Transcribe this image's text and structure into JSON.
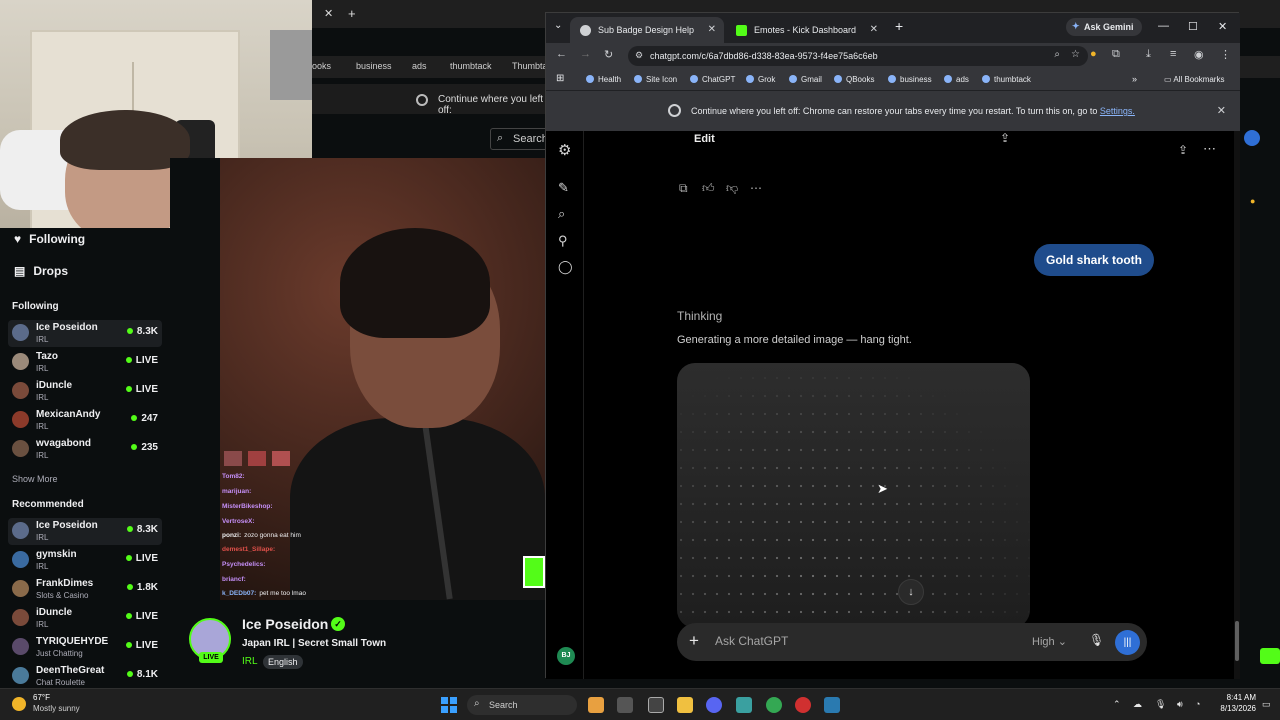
{
  "background_browser": {
    "bookmarks": [
      "ooks",
      "business",
      "ads",
      "thumbtack",
      "Thumbta"
    ],
    "restore_text": "Continue where you left off:",
    "search_label": "Search",
    "gemini_label": "Ask Gemini",
    "bookmarks_right": "ookmarks"
  },
  "kick": {
    "nav": {
      "following": "Following",
      "drops": "Drops"
    },
    "following_heading": "Following",
    "following": [
      {
        "name": "Ice Poseidon",
        "category": "IRL",
        "stat": "8.3K"
      },
      {
        "name": "Tazo",
        "category": "IRL",
        "stat": "LIVE"
      },
      {
        "name": "iDuncle",
        "category": "IRL",
        "stat": "LIVE"
      },
      {
        "name": "MexicanAndy",
        "category": "IRL",
        "stat": "247"
      },
      {
        "name": "wvagabond",
        "category": "IRL",
        "stat": "235"
      }
    ],
    "show_more": "Show More",
    "recommended_heading": "Recommended",
    "recommended": [
      {
        "name": "Ice Poseidon",
        "category": "IRL",
        "stat": "8.3K"
      },
      {
        "name": "gymskin",
        "category": "IRL",
        "stat": "LIVE"
      },
      {
        "name": "FrankDimes",
        "category": "Slots & Casino",
        "stat": "1.8K"
      },
      {
        "name": "iDuncle",
        "category": "IRL",
        "stat": "LIVE"
      },
      {
        "name": "TYRIQUEHYDE",
        "category": "Just Chatting",
        "stat": "LIVE"
      },
      {
        "name": "DeenTheGreat",
        "category": "Chat Roulette",
        "stat": "8.1K"
      }
    ],
    "chat": [
      {
        "user": "Tom82:",
        "text": ""
      },
      {
        "user": "marijuan:",
        "text": ""
      },
      {
        "user": "MisterBikeshop:",
        "text": ""
      },
      {
        "user": "VertroseX:",
        "text": ""
      },
      {
        "user": "ponzi:",
        "text": "zozo gonna eat him"
      },
      {
        "user": "demest1_Sillape:",
        "text": ""
      },
      {
        "user": "Psychedelics:",
        "text": ""
      },
      {
        "user": "briancf:",
        "text": ""
      },
      {
        "user": "k_DEDb07:",
        "text": "pet me too lmao"
      }
    ],
    "channel": {
      "name": "Ice Poseidon",
      "title": "Japan IRL | Secret Small Town",
      "category": "IRL",
      "language": "English",
      "live_badge": "LIVE"
    }
  },
  "chrome": {
    "tabs": [
      {
        "label": "Sub Badge Design Help",
        "active": true
      },
      {
        "label": "Emotes - Kick Dashboard",
        "active": false
      }
    ],
    "new_tab": "+",
    "ask_gemini": "Ask Gemini",
    "url": "chatgpt.com/c/6a7dbd86-d338-83ea-9573-f4ee75a6c6eb",
    "bookmarks": [
      "Health",
      "Site Icon",
      "ChatGPT",
      "Grok",
      "Gmail",
      "QBooks",
      "business",
      "ads",
      "thumbtack"
    ],
    "all_bookmarks": "All Bookmarks",
    "restore": {
      "text": "Continue where you left off: Chrome can restore your tabs every time you restart. To turn this on, go to",
      "link": "Settings."
    }
  },
  "chatgpt": {
    "edit_label": "Edit",
    "user_message": "Gold shark tooth",
    "thinking": "Thinking",
    "generating": "Generating a more detailed image — hang tight.",
    "composer_placeholder": "Ask ChatGPT",
    "model": "High",
    "avatar_initials": "BJ"
  },
  "taskbar": {
    "temperature": "67°F",
    "weather": "Mostly sunny",
    "search": "Search",
    "time": "8:41 AM",
    "date": "8/13/2026"
  },
  "colors": {
    "kick_green": "#53fc18",
    "chatgpt_user_bubble": "#1f4c8c",
    "voice_button": "#2f6fd6"
  }
}
